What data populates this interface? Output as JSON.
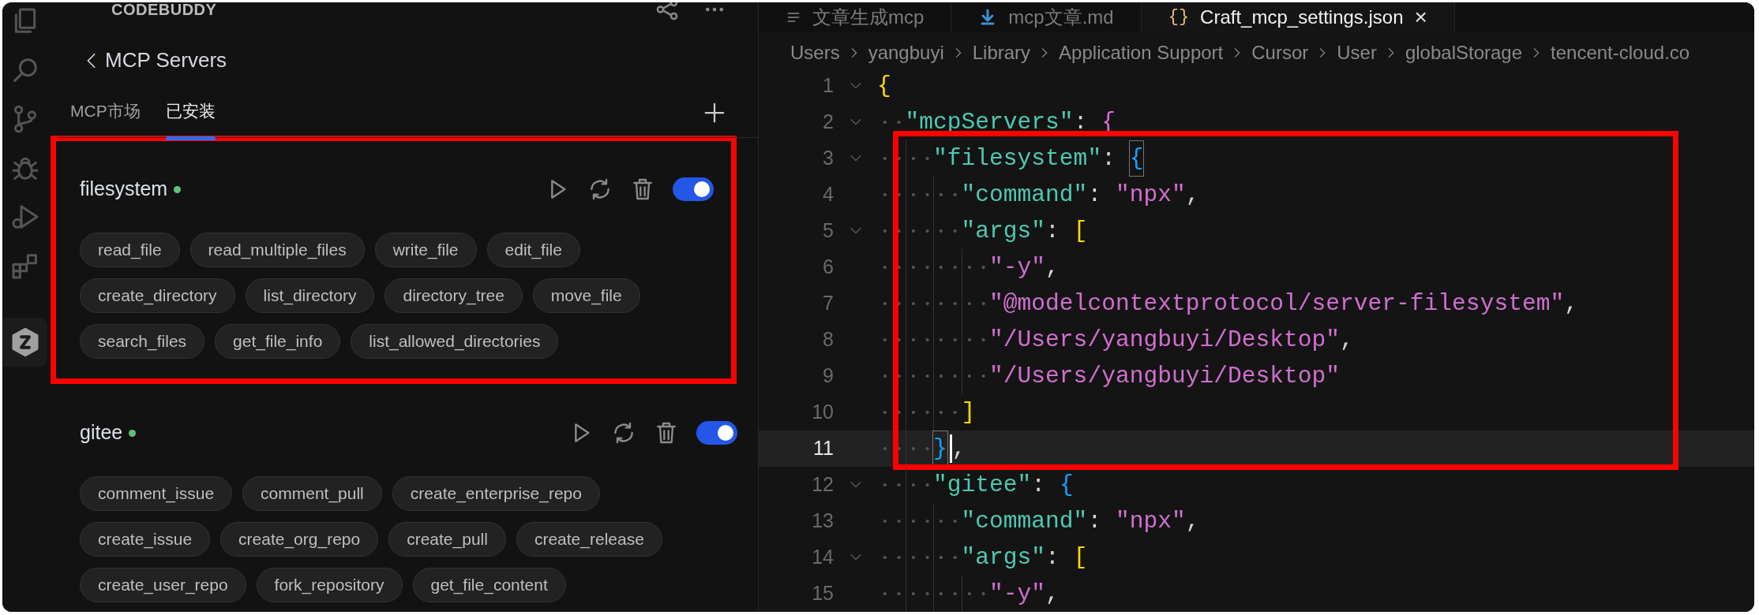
{
  "sidebar": {
    "title": "CODEBUDDY",
    "back_label": "MCP Servers",
    "tabs": [
      {
        "label": "MCP市场",
        "selected": false
      },
      {
        "label": "已安装",
        "selected": true
      }
    ],
    "servers": [
      {
        "name": "filesystem",
        "running": true,
        "on": true,
        "boxed": true,
        "tools": [
          "read_file",
          "read_multiple_files",
          "write_file",
          "edit_file",
          "create_directory",
          "list_directory",
          "directory_tree",
          "move_file",
          "search_files",
          "get_file_info",
          "list_allowed_directories"
        ]
      },
      {
        "name": "gitee",
        "running": true,
        "on": true,
        "boxed": false,
        "tools": [
          "comment_issue",
          "comment_pull",
          "create_enterprise_repo",
          "create_issue",
          "create_org_repo",
          "create_pull",
          "create_release",
          "create_user_repo",
          "fork_repository",
          "get_file_content"
        ]
      }
    ]
  },
  "editor": {
    "tabs": [
      {
        "kind": "outline",
        "label": "文章生成mcp",
        "selected": false
      },
      {
        "kind": "markdown",
        "label": "mcp文章.md",
        "selected": false
      },
      {
        "kind": "json",
        "icon": "{}",
        "label": "Craft_mcp_settings.json",
        "selected": true,
        "close": "×"
      }
    ],
    "breadcrumb": [
      "Users",
      "yangbuyi",
      "Library",
      "Application Support",
      "Cursor",
      "User",
      "globalStorage",
      "tencent-cloud.co"
    ],
    "lines": [
      {
        "number": "1",
        "foldable": true,
        "current": false,
        "boxed": false,
        "tokens": [
          {
            "kind": "bracket",
            "text": "{"
          }
        ],
        "children": [
          {
            "number": "2",
            "foldable": true,
            "current": false,
            "boxed": false,
            "tokens": [
              {
                "kind": "key",
                "text": "\"mcpServers\""
              },
              {
                "kind": "punct",
                "text": ": "
              },
              {
                "kind": "bracket",
                "text": "{"
              }
            ],
            "children": [
              {
                "number": "3",
                "foldable": true,
                "current": false,
                "boxed": true,
                "tokens": [
                  {
                    "kind": "key",
                    "text": "\"filesystem\""
                  },
                  {
                    "kind": "punct",
                    "text": ": "
                  },
                  {
                    "kind": "bracket",
                    "text": "{",
                    "matched": true
                  }
                ],
                "children": [
                  {
                    "number": "4",
                    "foldable": false,
                    "current": false,
                    "tokens": [
                      {
                        "kind": "key",
                        "text": "\"command\""
                      },
                      {
                        "kind": "punct",
                        "text": ": "
                      },
                      {
                        "kind": "string",
                        "text": "\"npx\""
                      },
                      {
                        "kind": "punct",
                        "text": ","
                      }
                    ]
                  },
                  {
                    "number": "5",
                    "foldable": true,
                    "current": false,
                    "boxed": false,
                    "tokens": [
                      {
                        "kind": "key",
                        "text": "\"args\""
                      },
                      {
                        "kind": "punct",
                        "text": ": "
                      },
                      {
                        "kind": "bracket",
                        "text": "["
                      }
                    ],
                    "children": [
                      {
                        "number": "6",
                        "foldable": false,
                        "current": false,
                        "tokens": [
                          {
                            "kind": "string",
                            "text": "\"-y\""
                          },
                          {
                            "kind": "punct",
                            "text": ","
                          }
                        ]
                      },
                      {
                        "number": "7",
                        "foldable": false,
                        "current": false,
                        "tokens": [
                          {
                            "kind": "string",
                            "text": "\"@modelcontextprotocol/server-filesystem\""
                          },
                          {
                            "kind": "punct",
                            "text": ","
                          }
                        ]
                      },
                      {
                        "number": "8",
                        "foldable": false,
                        "current": false,
                        "tokens": [
                          {
                            "kind": "string",
                            "text": "\"/Users/yangbuyi/Desktop\""
                          },
                          {
                            "kind": "punct",
                            "text": ","
                          }
                        ]
                      },
                      {
                        "number": "9",
                        "foldable": false,
                        "current": false,
                        "tokens": [
                          {
                            "kind": "string",
                            "text": "\"/Users/yangbuyi/Desktop\""
                          }
                        ]
                      }
                    ],
                    "close": {
                      "number": "10",
                      "foldable": false,
                      "current": false,
                      "tokens": [
                        {
                          "kind": "bracket",
                          "text": "]"
                        }
                      ]
                    }
                  }
                ],
                "close": {
                  "number": "11",
                  "foldable": false,
                  "current": true,
                  "tokens": [
                    {
                      "kind": "bracket",
                      "text": "}",
                      "matched": true,
                      "cursor_after": true
                    },
                    {
                      "kind": "punct",
                      "text": ","
                    }
                  ]
                }
              },
              {
                "number": "12",
                "foldable": true,
                "current": false,
                "boxed": false,
                "tokens": [
                  {
                    "kind": "key",
                    "text": "\"gitee\""
                  },
                  {
                    "kind": "punct",
                    "text": ": "
                  },
                  {
                    "kind": "bracket",
                    "text": "{"
                  }
                ],
                "children": [
                  {
                    "number": "13",
                    "foldable": false,
                    "current": false,
                    "tokens": [
                      {
                        "kind": "key",
                        "text": "\"command\""
                      },
                      {
                        "kind": "punct",
                        "text": ": "
                      },
                      {
                        "kind": "string",
                        "text": "\"npx\""
                      },
                      {
                        "kind": "punct",
                        "text": ","
                      }
                    ]
                  },
                  {
                    "number": "14",
                    "foldable": true,
                    "current": false,
                    "boxed": false,
                    "tokens": [
                      {
                        "kind": "key",
                        "text": "\"args\""
                      },
                      {
                        "kind": "punct",
                        "text": ": "
                      },
                      {
                        "kind": "bracket",
                        "text": "["
                      }
                    ],
                    "children": [
                      {
                        "number": "15",
                        "foldable": false,
                        "current": false,
                        "tokens": [
                          {
                            "kind": "string",
                            "text": "\"-y\""
                          },
                          {
                            "kind": "punct",
                            "text": ","
                          }
                        ]
                      }
                    ]
                  }
                ]
              }
            ]
          }
        ]
      }
    ]
  }
}
